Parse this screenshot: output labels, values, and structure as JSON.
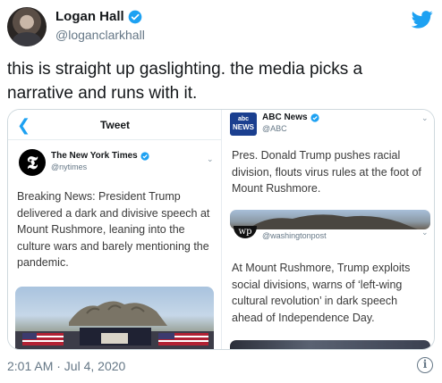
{
  "author": {
    "display_name": "Logan Hall",
    "handle": "@loganclarkhall"
  },
  "tweet": {
    "text": "this is straight up gaslighting. the media picks a narrative and runs with it.",
    "timestamp": "2:01 AM · Jul 4, 2020"
  },
  "embedded": {
    "left": {
      "nav_title": "Tweet",
      "author_name": "The New York Times",
      "author_handle": "@nytimes",
      "logo_glyph": "𝕿",
      "body": "Breaking News: President Trump delivered a dark and divisive speech at Mount Rushmore, leaning into the culture wars and barely mentioning the pandemic."
    },
    "right": {
      "abc_logo_top": "abc",
      "abc_logo_bottom": "NEWS",
      "abc_name": "ABC News",
      "abc_handle": "@ABC",
      "abc_body": "Pres. Donald Trump pushes racial division, flouts virus rules at the foot of Mount Rushmore.",
      "wapo_handle": "@washingtonpost",
      "wapo_logo_glyph": "wp",
      "wapo_body": "At Mount Rushmore, Trump exploits social divisions, warns of ‘left-wing cultural revolution’ in dark speech ahead of Independence Day."
    }
  },
  "icons": {
    "verified": "verified-badge-icon",
    "twitter": "twitter-bird-icon",
    "info": "info-icon",
    "back": "back-chevron-icon",
    "more": "chevron-down-icon"
  },
  "colors": {
    "twitter_blue": "#1da1f2",
    "text": "#14171a",
    "muted": "#657786"
  }
}
